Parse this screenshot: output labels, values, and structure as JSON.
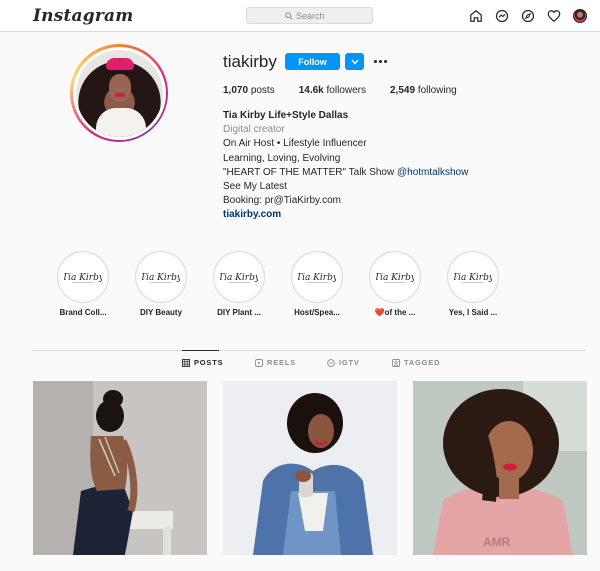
{
  "nav": {
    "logo": "Instagram",
    "search_placeholder": "Search",
    "icons": [
      "home-icon",
      "messenger-icon",
      "explore-icon",
      "heart-icon",
      "profile-avatar"
    ]
  },
  "profile": {
    "username": "tiakirby",
    "follow_label": "Follow",
    "stats": {
      "posts_count": "1,070",
      "posts_label": "posts",
      "followers_count": "14.6k",
      "followers_label": "followers",
      "following_count": "2,549",
      "following_label": "following"
    },
    "bio": {
      "name": "Tia Kirby Life+Style Dallas",
      "category": "Digital creator",
      "line1": "On Air Host • Lifestyle Influencer",
      "line2": "Learning, Loving, Evolving",
      "line3_text": "\"HEART OF THE MATTER\" Talk Show ",
      "line3_tag": "@hotmtalkshow",
      "line4": "See My Latest",
      "line5": "Booking: pr@TiaKirby.com",
      "website": "tiakirby.com"
    }
  },
  "highlights": [
    {
      "label": "Brand Coll...",
      "cover_text": "Tia Kirby"
    },
    {
      "label": "DIY Beauty",
      "cover_text": "Tia Kirby"
    },
    {
      "label": "DIY Plant ...",
      "cover_text": "Tia Kirby"
    },
    {
      "label": "Host/Spea...",
      "cover_text": "Tia Kirby"
    },
    {
      "label": "of the ...",
      "emoji": "❤️",
      "cover_text": "Tia Kirby"
    },
    {
      "label": "Yes, I Said ...",
      "cover_text": "Tia Kirby"
    }
  ],
  "tabs": [
    {
      "label": "POSTS",
      "icon": "grid-icon",
      "active": true
    },
    {
      "label": "REELS",
      "icon": "reels-icon",
      "active": false
    },
    {
      "label": "IGTV",
      "icon": "igtv-icon",
      "active": false
    },
    {
      "label": "TAGGED",
      "icon": "tagged-icon",
      "active": false
    }
  ],
  "colors": {
    "accent": "#0095f6",
    "link": "#00376b",
    "muted": "#8e8e8e",
    "text": "#262626"
  }
}
